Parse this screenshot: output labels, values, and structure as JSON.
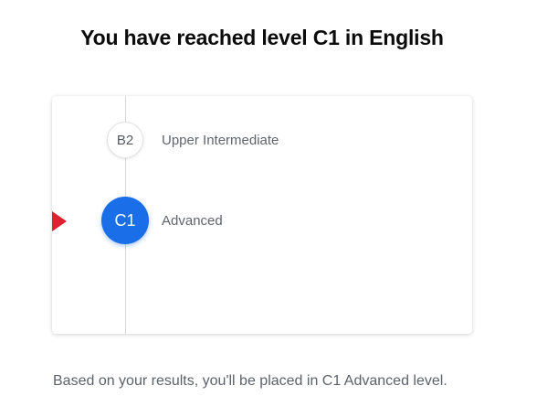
{
  "headline": "You have reached level C1 in English",
  "levels": [
    {
      "code": "B2",
      "name": "Upper Intermediate",
      "state": "passed"
    },
    {
      "code": "C1",
      "name": "Advanced",
      "state": "current"
    }
  ],
  "current_marker_icon": "red-triangle-pointer",
  "result_text": "Based on your results, you'll be placed in C1 Advanced level.",
  "colors": {
    "current_level": "#1a6ee8",
    "marker": "#e0202f",
    "headline": "#0b0b0b",
    "secondary_text": "#60656b"
  }
}
